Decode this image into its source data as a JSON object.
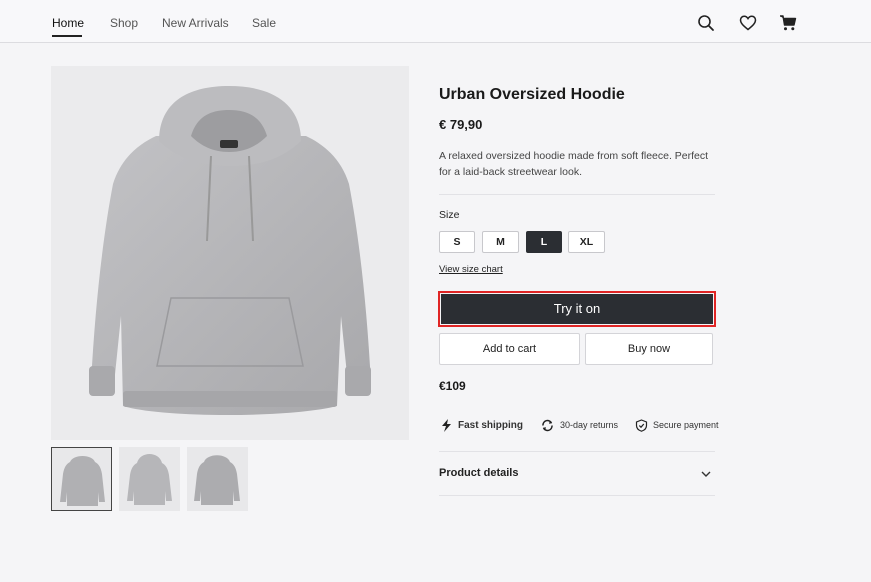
{
  "nav": {
    "items": [
      {
        "label": "Home",
        "active": true
      },
      {
        "label": "Shop"
      },
      {
        "label": "New Arrivals"
      },
      {
        "label": "Sale"
      }
    ],
    "icons": [
      "search-icon",
      "heart-icon",
      "cart-icon"
    ]
  },
  "product": {
    "title": "Urban Oversized Hoodie",
    "price": "€ 79,90",
    "description": "A relaxed oversized hoodie made from soft fleece. Perfect for a laid-back streetwear look.",
    "size_label": "Size",
    "sizes": [
      {
        "label": "S"
      },
      {
        "label": "M"
      },
      {
        "label": "L",
        "selected": true
      },
      {
        "label": "XL"
      }
    ],
    "size_chart_link": "View size chart",
    "try_on_label": "Try it on",
    "add_to_cart_label": "Add to cart",
    "buy_now_label": "Buy now",
    "secondary_price": "€109",
    "features": [
      {
        "icon": "lightning-icon",
        "label": "Fast shipping"
      },
      {
        "icon": "returns-icon",
        "label": "30-day returns"
      },
      {
        "icon": "shield-icon",
        "label": "Secure payment"
      }
    ],
    "details_label": "Product details"
  },
  "gallery": {
    "thumbnail_count": 3,
    "selected_index": 0
  },
  "colors": {
    "primary_button": "#2b2e33",
    "highlight_outline": "#e02525",
    "hoodie": "#b4b4b7"
  }
}
